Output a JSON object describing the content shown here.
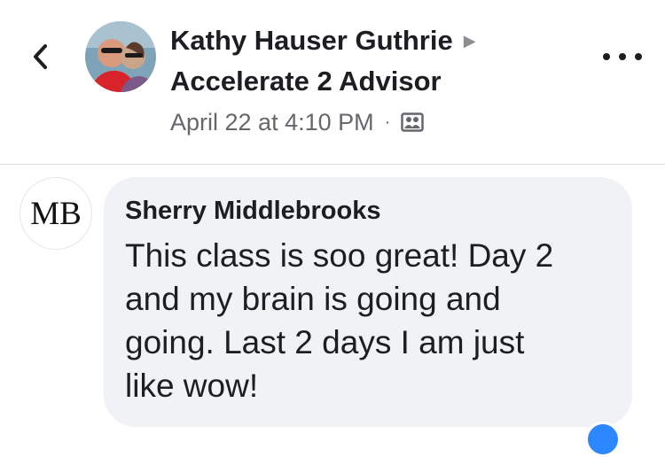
{
  "post": {
    "author": "Kathy Hauser Guthrie",
    "group": "Accelerate 2 Advisor",
    "timestamp": "April 22 at 4:10 PM",
    "separator": "·",
    "audience_icon": "group-audience-icon"
  },
  "icons": {
    "back": "chevron-left-icon",
    "more": "more-options-icon",
    "arrow": "triangle-right-icon"
  },
  "comment": {
    "avatar_initials": "MB",
    "author": "Sherry Middlebrooks",
    "text_lines": [
      "This class is soo great! Day 2",
      "and my brain is going and",
      "going. Last 2 days I am just",
      "like wow!"
    ]
  },
  "colors": {
    "bubble": "#f0f2f5",
    "secondary_text": "#65676b",
    "reaction": "#2d88ff"
  }
}
